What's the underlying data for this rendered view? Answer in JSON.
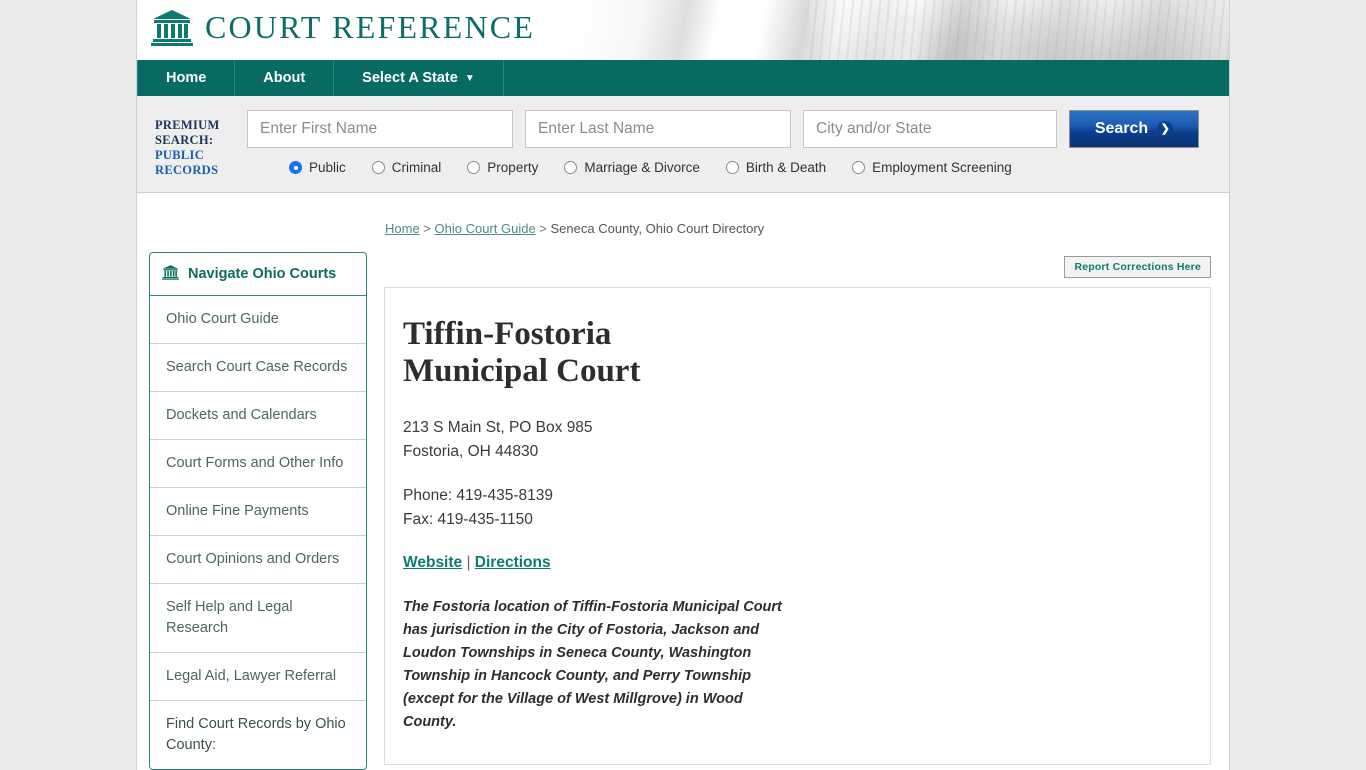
{
  "site": {
    "brand_title": "COURT REFERENCE",
    "brand_icon": "courthouse-icon"
  },
  "nav": {
    "items": [
      {
        "label": "Home"
      },
      {
        "label": "About"
      },
      {
        "label": "Select A State",
        "caret": "▼"
      }
    ]
  },
  "premium_search": {
    "label_line1": "PREMIUM",
    "label_line2": "SEARCH:",
    "label_line3": "PUBLIC",
    "label_line4": "RECORDS",
    "first_name_placeholder": "Enter First Name",
    "first_name_value": "",
    "last_name_placeholder": "Enter Last Name",
    "last_name_value": "",
    "city_state_placeholder": "City and/or State",
    "city_state_value": "",
    "search_button_label": "Search",
    "search_button_icon": "❯",
    "radios": [
      {
        "label": "Public",
        "selected": true
      },
      {
        "label": "Criminal",
        "selected": false
      },
      {
        "label": "Property",
        "selected": false
      },
      {
        "label": "Marriage & Divorce",
        "selected": false
      },
      {
        "label": "Birth & Death",
        "selected": false
      },
      {
        "label": "Employment Screening",
        "selected": false
      }
    ]
  },
  "breadcrumb": {
    "home": "Home",
    "sep1": " > ",
    "guide": "Ohio Court Guide",
    "sep2": " > ",
    "current": "Seneca County, Ohio Court Directory"
  },
  "corrections": {
    "label": "Report Corrections Here"
  },
  "sidebar": {
    "header": "Navigate Ohio Courts",
    "header_icon": "courthouse-icon",
    "items": [
      {
        "label": "Ohio Court Guide"
      },
      {
        "label": "Search Court Case Records"
      },
      {
        "label": "Dockets and Calendars"
      },
      {
        "label": "Court Forms and Other Info"
      },
      {
        "label": "Online Fine Payments"
      },
      {
        "label": "Court Opinions and Orders"
      },
      {
        "label": "Self Help and Legal Research"
      },
      {
        "label": "Legal Aid, Lawyer Referral"
      },
      {
        "label": "Find Court Records by Ohio County:"
      }
    ]
  },
  "court": {
    "title": "Tiffin-Fostoria Municipal Court",
    "address_line1": "213 S Main St, PO Box 985",
    "address_line2": "Fostoria, OH 44830",
    "phone": "Phone: 419-435-8139",
    "fax": "Fax: 419-435-1150",
    "website_label": "Website",
    "link_sep": " | ",
    "directions_label": "Directions",
    "description": "The Fostoria location of Tiffin-Fostoria Municipal Court has jurisdiction in the City of Fostoria, Jackson and Loudon Townships in Seneca County, Washington Township in Hancock County, and Perry Township (except for the Village of West Millgrove) in Wood County."
  },
  "colors": {
    "teal": "#076b63",
    "link_teal": "#0d7b71",
    "button_blue": "#1b5ab0",
    "radio_blue": "#1a73e8",
    "page_bg": "#ececec"
  }
}
